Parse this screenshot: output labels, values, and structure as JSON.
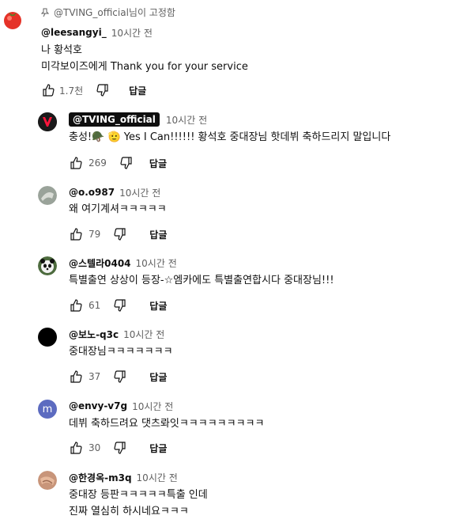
{
  "pinned": {
    "label": "@TVING_official님이 고정함"
  },
  "main_comment": {
    "author": "@leesangyi_",
    "time": "10시간 전",
    "lines": [
      "나 황석호",
      "미각보이즈에게 Thank you for your service"
    ],
    "likes": "1.7천",
    "reply_label": "답글"
  },
  "replies": [
    {
      "author": "@TVING_official",
      "owner": true,
      "time": "10시간 전",
      "lines": [
        "충성!🪖 🫡 Yes I Can!!!!!! 황석호 중대장님 핫데뷔 축하드리지 말입니다"
      ],
      "likes": "269",
      "reply_label": "답글"
    },
    {
      "author": "@o.o987",
      "time": "10시간 전",
      "lines": [
        "왜 여기계셔ㅋㅋㅋㅋㅋ"
      ],
      "likes": "79",
      "reply_label": "답글"
    },
    {
      "author": "@스텔라0404",
      "time": "10시간 전",
      "lines": [
        "특별출연 상상이 등장-☆엠카에도 특별출연합시다 중대장님!!!"
      ],
      "likes": "61",
      "reply_label": "답글"
    },
    {
      "author": "@보노-q3c",
      "time": "10시간 전",
      "lines": [
        "중대장님ㅋㅋㅋㅋㅋㅋㅋ"
      ],
      "likes": "37",
      "reply_label": "답글"
    },
    {
      "author": "@envy-v7g",
      "time": "10시간 전",
      "lines": [
        "데뷔 축하드려요 댓츠롸잇ㅋㅋㅋㅋㅋㅋㅋㅋㅋ"
      ],
      "likes": "30",
      "reply_label": "답글",
      "avatar_letter": "m"
    },
    {
      "author": "@한경옥-m3q",
      "time": "10시간 전",
      "lines": [
        "중대장 등판ㅋㅋㅋㅋㅋ특출 인데",
        "진짜 열심히 하시네요ㅋㅋㅋ"
      ]
    }
  ],
  "colors": {
    "owner_badge": "#0f0f0f",
    "envy_avatar": "#5c6bc0"
  }
}
